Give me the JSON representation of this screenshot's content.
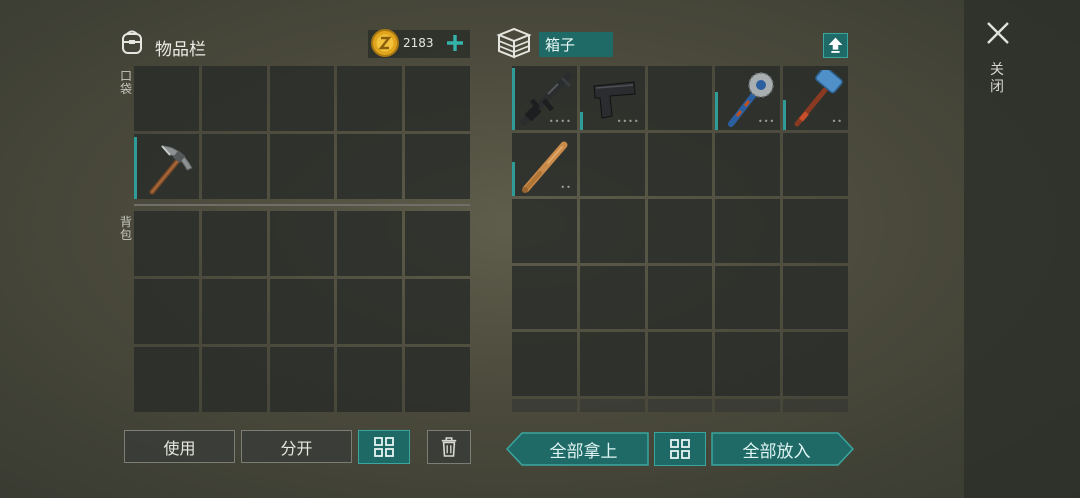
{
  "inventory": {
    "title": "物品栏",
    "icon": "backpack-icon",
    "coins": "2183",
    "pocket_label": "口袋",
    "backpack_label": "背包",
    "pocket_slots": [
      {
        "item": null
      },
      {
        "item": null
      },
      {
        "item": null
      },
      {
        "item": null
      },
      {
        "item": null
      },
      {
        "item": "pickaxe"
      },
      {
        "item": null
      },
      {
        "item": null
      },
      {
        "item": null
      },
      {
        "item": null
      }
    ],
    "backpack_slots": 15
  },
  "box": {
    "title": "箱子",
    "icon": "box-stack-icon",
    "slots": [
      {
        "item": "assault-rifle",
        "durability": "••••"
      },
      {
        "item": "pistol",
        "durability": "••••"
      },
      {
        "item": null
      },
      {
        "item": "saw-mace",
        "durability": "•••"
      },
      {
        "item": "sledgehammer",
        "durability": "••"
      },
      {
        "item": "baseball-bat",
        "durability": "••"
      }
    ],
    "total_slots": 25
  },
  "buttons": {
    "use": "使用",
    "split": "分开",
    "take_all": "全部拿上",
    "put_all": "全部放入",
    "close": "关闭"
  },
  "colors": {
    "accent_teal": "#1f6a66",
    "accent_teal_light": "#3aa6a0",
    "slot_bar": "#2f9c99",
    "coin_gold": "#e0a51c"
  }
}
